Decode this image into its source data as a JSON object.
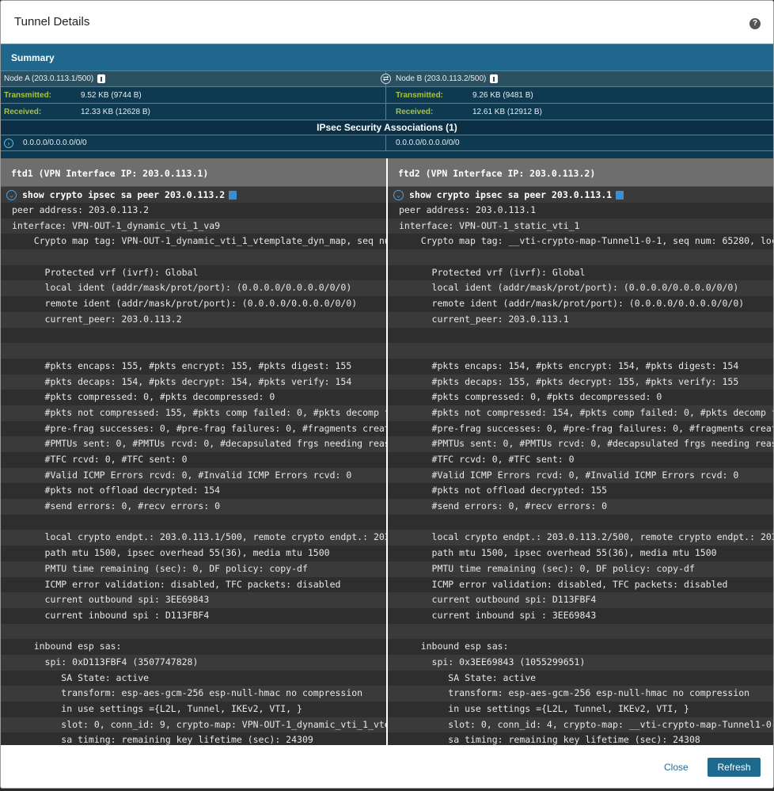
{
  "dialog": {
    "title": "Tunnel Details",
    "help_icon": "?"
  },
  "summary": {
    "title": "Summary",
    "node_a": "Node A (203.0.113.1/500)",
    "node_b": "Node B (203.0.113.2/500)",
    "transmitted_label": "Transmitted:",
    "received_label": "Received:",
    "a_transmitted": "9.52 KB (9744 B)",
    "a_received": "12.33 KB (12628 B)",
    "b_transmitted": "9.26 KB (9481 B)",
    "b_received": "12.61 KB (12912 B)",
    "sa_header": "IPsec Security Associations (1)",
    "sa_a": "0.0.0.0/0.0.0.0/0/0",
    "sa_b": "0.0.0.0/0.0.0.0/0/0"
  },
  "left": {
    "header": "ftd1 (VPN Interface IP: 203.0.113.1)",
    "command": "show crypto ipsec sa peer 203.0.113.2",
    "lines": [
      "peer address: 203.0.113.2",
      "interface: VPN-OUT-1_dynamic_vti_1_va9",
      "    Crypto map tag: VPN-OUT-1_dynamic_vti_1_vtemplate_dyn_map, seq nu",
      "",
      "      Protected vrf (ivrf): Global",
      "      local ident (addr/mask/prot/port): (0.0.0.0/0.0.0.0/0/0)",
      "      remote ident (addr/mask/prot/port): (0.0.0.0/0.0.0.0/0/0)",
      "      current_peer: 203.0.113.2",
      "",
      "",
      "      #pkts encaps: 155, #pkts encrypt: 155, #pkts digest: 155",
      "      #pkts decaps: 154, #pkts decrypt: 154, #pkts verify: 154",
      "      #pkts compressed: 0, #pkts decompressed: 0",
      "      #pkts not compressed: 155, #pkts comp failed: 0, #pkts decomp f",
      "      #pre-frag successes: 0, #pre-frag failures: 0, #fragments creat",
      "      #PMTUs sent: 0, #PMTUs rcvd: 0, #decapsulated frgs needing reas",
      "      #TFC rcvd: 0, #TFC sent: 0",
      "      #Valid ICMP Errors rcvd: 0, #Invalid ICMP Errors rcvd: 0",
      "      #pkts not offload decrypted: 154",
      "      #send errors: 0, #recv errors: 0",
      "",
      "      local crypto endpt.: 203.0.113.1/500, remote crypto endpt.: 203",
      "      path mtu 1500, ipsec overhead 55(36), media mtu 1500",
      "      PMTU time remaining (sec): 0, DF policy: copy-df",
      "      ICMP error validation: disabled, TFC packets: disabled",
      "      current outbound spi: 3EE69843",
      "      current inbound spi : D113FBF4",
      "",
      "    inbound esp sas:",
      "      spi: 0xD113FBF4 (3507747828)",
      "         SA State: active",
      "         transform: esp-aes-gcm-256 esp-null-hmac no compression",
      "         in use settings ={L2L, Tunnel, IKEv2, VTI, }",
      "         slot: 0, conn_id: 9, crypto-map: VPN-OUT-1_dynamic_vti_1_vte",
      "         sa timing: remaining key lifetime (sec): 24309"
    ]
  },
  "right": {
    "header": "ftd2 (VPN Interface IP: 203.0.113.2)",
    "command": "show crypto ipsec sa peer 203.0.113.1",
    "lines": [
      "peer address: 203.0.113.1",
      "interface: VPN-OUT-1_static_vti_1",
      "    Crypto map tag: __vti-crypto-map-Tunnel1-0-1, seq num: 65280, loc",
      "",
      "      Protected vrf (ivrf): Global",
      "      local ident (addr/mask/prot/port): (0.0.0.0/0.0.0.0/0/0)",
      "      remote ident (addr/mask/prot/port): (0.0.0.0/0.0.0.0/0/0)",
      "      current_peer: 203.0.113.1",
      "",
      "",
      "      #pkts encaps: 154, #pkts encrypt: 154, #pkts digest: 154",
      "      #pkts decaps: 155, #pkts decrypt: 155, #pkts verify: 155",
      "      #pkts compressed: 0, #pkts decompressed: 0",
      "      #pkts not compressed: 154, #pkts comp failed: 0, #pkts decomp f",
      "      #pre-frag successes: 0, #pre-frag failures: 0, #fragments creat",
      "      #PMTUs sent: 0, #PMTUs rcvd: 0, #decapsulated frgs needing reas",
      "      #TFC rcvd: 0, #TFC sent: 0",
      "      #Valid ICMP Errors rcvd: 0, #Invalid ICMP Errors rcvd: 0",
      "      #pkts not offload decrypted: 155",
      "      #send errors: 0, #recv errors: 0",
      "",
      "      local crypto endpt.: 203.0.113.2/500, remote crypto endpt.: 203",
      "      path mtu 1500, ipsec overhead 55(36), media mtu 1500",
      "      PMTU time remaining (sec): 0, DF policy: copy-df",
      "      ICMP error validation: disabled, TFC packets: disabled",
      "      current outbound spi: D113FBF4",
      "      current inbound spi : 3EE69843",
      "",
      "    inbound esp sas:",
      "      spi: 0x3EE69843 (1055299651)",
      "         SA State: active",
      "         transform: esp-aes-gcm-256 esp-null-hmac no compression",
      "         in use settings ={L2L, Tunnel, IKEv2, VTI, }",
      "         slot: 0, conn_id: 4, crypto-map: __vti-crypto-map-Tunnel1-0-",
      "         sa timing: remaining key lifetime (sec): 24308"
    ]
  },
  "footer": {
    "close_label": "Close",
    "refresh_label": "Refresh"
  }
}
